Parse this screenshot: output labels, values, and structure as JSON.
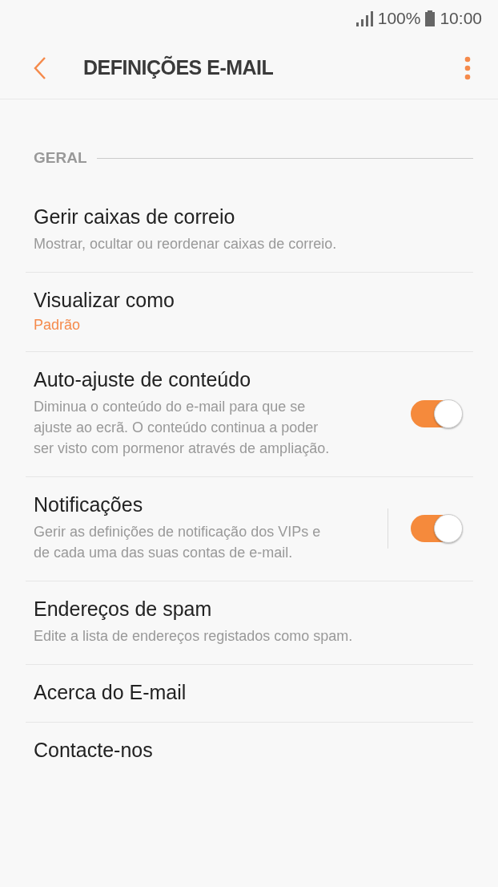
{
  "status_bar": {
    "battery": "100%",
    "time": "10:00"
  },
  "header": {
    "title": "DEFINIÇÕES E-MAIL"
  },
  "section": {
    "title": "GERAL"
  },
  "items": [
    {
      "kind": "plain",
      "title": "Gerir caixas de correio",
      "subtitle": "Mostrar, ocultar ou reordenar caixas de correio."
    },
    {
      "kind": "value",
      "title": "Visualizar como",
      "value": "Padrão"
    },
    {
      "kind": "switch",
      "title": "Auto-ajuste de conteúdo",
      "subtitle": "Diminua o conteúdo do e-mail para que se ajuste ao ecrã. O conteúdo continua a poder ser visto com pormenor através de ampliação.",
      "on": true,
      "split": false
    },
    {
      "kind": "switch",
      "title": "Notificações",
      "subtitle": "Gerir as definições de notificação dos VIPs e de cada uma das suas contas de e-mail.",
      "on": true,
      "split": true
    },
    {
      "kind": "plain",
      "title": "Endereços de spam",
      "subtitle": "Edite a lista de endereços registados como spam."
    },
    {
      "kind": "plain",
      "title": "Acerca do E-mail"
    },
    {
      "kind": "plain",
      "title": "Contacte-nos"
    }
  ]
}
